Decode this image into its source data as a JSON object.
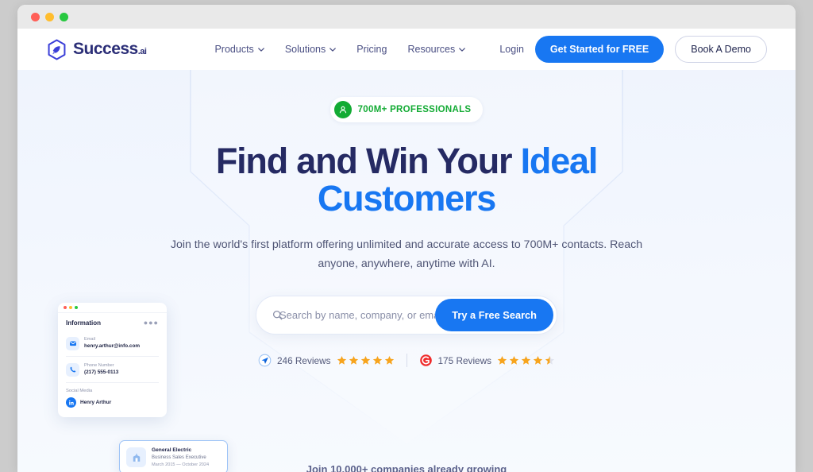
{
  "window": {
    "traffic_lights": [
      "#ff5f57",
      "#ffbd2e",
      "#28c840"
    ]
  },
  "header": {
    "logo": {
      "text": "Success",
      "suffix": ".ai",
      "icon": "rocket-hexagon-icon"
    },
    "nav": [
      {
        "label": "Products",
        "has_caret": true
      },
      {
        "label": "Solutions",
        "has_caret": true
      },
      {
        "label": "Pricing",
        "has_caret": false
      },
      {
        "label": "Resources",
        "has_caret": true
      }
    ],
    "login_label": "Login",
    "cta_primary": "Get Started for FREE",
    "cta_secondary": "Book A Demo"
  },
  "hero": {
    "badge": {
      "text": "700M+ PROFESSIONALS",
      "icon": "person-icon",
      "color": "#13ab34"
    },
    "headline_line1": "Find and Win Your ",
    "headline_accent1": "Ideal",
    "headline_accent2": "Customers",
    "subhead": "Join the world's first platform offering unlimited and accurate access to 700M+ contacts. Reach anyone, anywhere, anytime with AI.",
    "search": {
      "placeholder": "Search by name, company, or email",
      "value": "",
      "button_label": "Try a Free Search",
      "icon": "search-icon"
    },
    "reviews": [
      {
        "count_label": "246 Reviews",
        "stars": 5,
        "half": false,
        "icon": "trustpilot-icon",
        "icon_color": "#1877f2"
      },
      {
        "count_label": "175 Reviews",
        "stars": 4,
        "half": true,
        "icon": "g2-icon",
        "icon_color": "#ef2b2b"
      }
    ],
    "star_color": "#f7a41d",
    "bottom_note": "Join 10,000+ companies already growing"
  },
  "info_card": {
    "title": "Information",
    "menu_icon": "more-options-icon",
    "rows": [
      {
        "label": "Email",
        "value": "henry.arthur@info.com",
        "icon": "envelope-icon"
      },
      {
        "label": "Phone Number",
        "value": "(217) 555-0113",
        "icon": "phone-icon"
      }
    ],
    "social_label": "Social Media",
    "social_name": "Henry Arthur",
    "social_icon": "linkedin-icon"
  },
  "company_card": {
    "name": "General Electric",
    "role": "Business Sales Executive",
    "dates": "March 2015  —  October 2024",
    "icon": "building-icon"
  },
  "colors": {
    "accent_blue": "#1877f2",
    "navy": "#252a63",
    "green": "#13ab34",
    "star": "#f7a41d"
  }
}
